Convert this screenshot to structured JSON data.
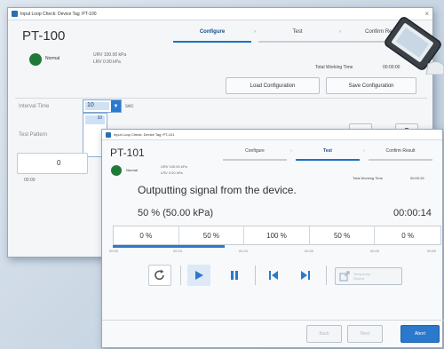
{
  "back_window": {
    "title": "Input Loop Check: Device Tag :PT-100",
    "device_tag": "PT-100",
    "status": "Normal",
    "urv": "URV 100.00 kPa",
    "lrv": "LRV 0.00 kPa",
    "steps": [
      "Configure",
      "Test",
      "Confirm Result"
    ],
    "step_sep": "›",
    "total_working_time_label": "Total Working Time",
    "total_working_time": "00:00:00",
    "load_config_label": "Load Configuration",
    "save_config_label": "Save Configuration",
    "interval_label": "Interval Time",
    "interval_value": "10",
    "interval_unit": "sec",
    "interval_options": [
      "10"
    ],
    "test_pattern_label": "Test Pattern",
    "pattern_value": "0",
    "pattern_time": "00:00",
    "close_glyph": "×"
  },
  "front_window": {
    "title": "Input Loop Check: Device Tag :PT-101",
    "device_tag": "PT-101",
    "status": "Normal",
    "urv": "URV 100.00 kPa",
    "lrv": "LRV 0.00 kPa",
    "steps": [
      "Configure",
      "Test",
      "Confirm Result"
    ],
    "step_sep": "›",
    "total_working_time_label": "Total Working Time",
    "total_working_time": "00:00:25",
    "message": "Outputting signal from the device.",
    "progress_text": "50 % (50.00 kPa)",
    "elapsed": "00:00:14",
    "segments": [
      "0 %",
      "50 %",
      "100 %",
      "50 %",
      "0 %"
    ],
    "current_segment": 1,
    "segment_fill": 0.7,
    "timeline_labels": [
      "00:00",
      "00:10",
      "00:20",
      "00:30",
      "00:40",
      "00:50"
    ],
    "controls": {
      "restart_icon": "restart-icon",
      "play_icon": "play-icon",
      "pause_icon": "pause-icon",
      "prev_icon": "skip-previous-icon",
      "next_icon": "skip-next-icon",
      "temp_output_label": "Temporary Output"
    },
    "back_label": "Back",
    "next_label": "Next",
    "abort_label": "Abort",
    "accent": "#2b79cc"
  }
}
